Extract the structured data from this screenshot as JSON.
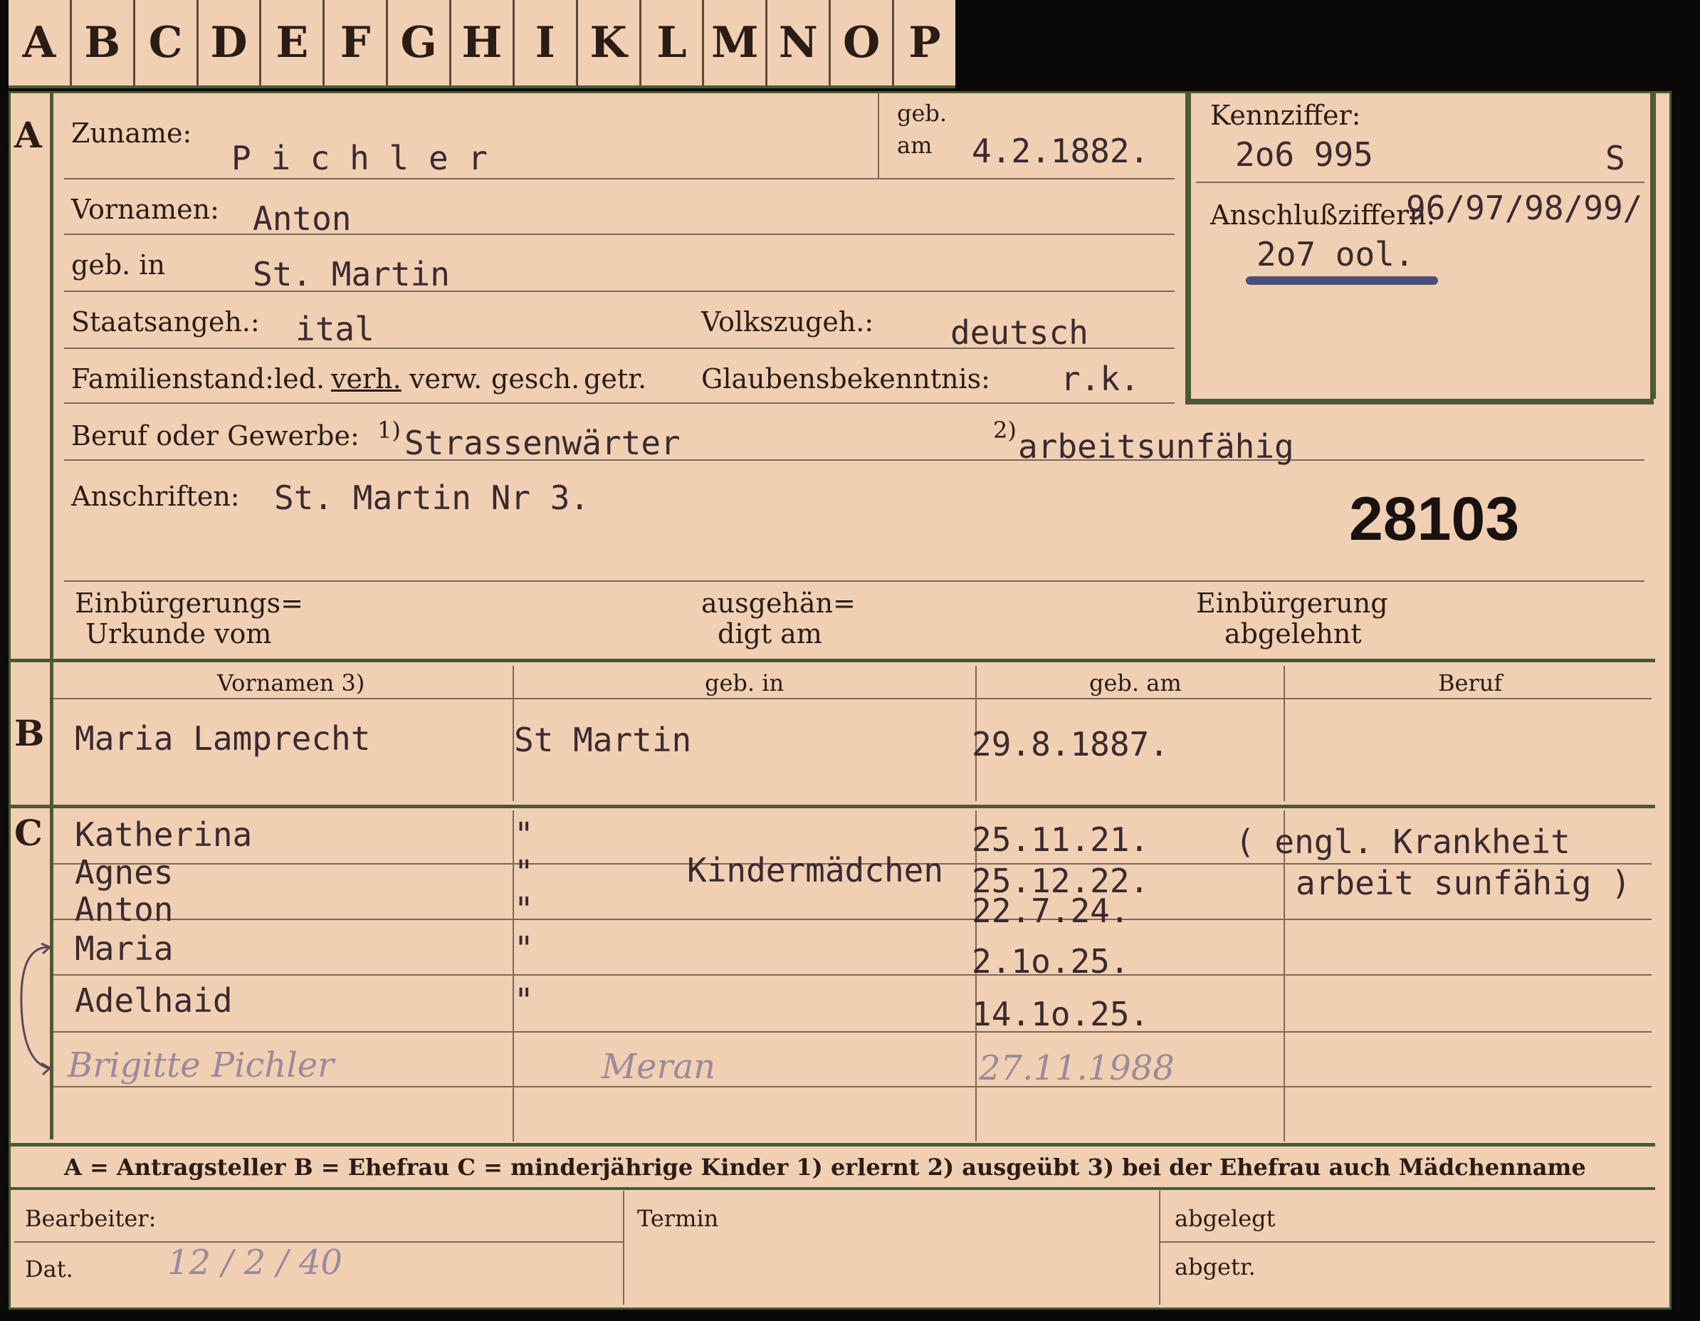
{
  "tabs": [
    "A",
    "B",
    "C",
    "D",
    "E",
    "F",
    "G",
    "H",
    "I",
    "K",
    "L",
    "M",
    "N",
    "O",
    "P"
  ],
  "section_a": {
    "marker": "A",
    "zuname_label": "Zuname:",
    "zuname": "P i c h l e r",
    "geb_label": "geb.",
    "am_label": "am",
    "geb_am": "4.2.1882.",
    "vornamen_label": "Vornamen:",
    "vornamen": "Anton",
    "geb_in_label": "geb. in",
    "geb_in": "St. Martin",
    "staatsangeh_label": "Staatsangeh.:",
    "staatsangeh": "ital",
    "volkszugeh_label": "Volkszugeh.:",
    "volkszugeh": "deutsch",
    "familienstand_label": "Familienstand:",
    "familienstand_options": [
      "led.",
      "verh.",
      "verw.",
      "gesch.",
      "getr."
    ],
    "glaubens_label": "Glaubensbekenntnis:",
    "glaubens": "r.k.",
    "beruf_label": "Beruf oder Gewerbe:",
    "beruf_note1": "1)",
    "beruf": "Strassenwärter",
    "beruf_note2": "2)",
    "beruf2": "arbeitsunfähig",
    "anschriften_label": "Anschriften:",
    "anschriften": "St. Martin Nr 3.",
    "stamp_number": "28103",
    "einb_urkunde_line1": "Einbürgerungs=",
    "einb_urkunde_line2": "Urkunde vom",
    "ausgehaendigt_line1": "ausgehän=",
    "ausgehaendigt_line2": "digt am",
    "einb_abgelehnt_line1": "Einbürgerung",
    "einb_abgelehnt_line2": "abgelehnt"
  },
  "kennziffer": {
    "label": "Kennziffer:",
    "value": "2o6 995",
    "suffix": "S",
    "anschluss_label": "Anschlußziffern:",
    "anschluss_value": "96/97/98/99/",
    "anschluss_value2": "2o7 ool."
  },
  "section_b": {
    "marker": "B",
    "col_vornamen": "Vornamen 3)",
    "col_geb_in": "geb. in",
    "col_geb_am": "geb. am",
    "col_beruf": "Beruf",
    "vornamen": "Maria Lamprecht",
    "geb_in": "St Martin",
    "geb_am": "29.8.1887."
  },
  "section_c": {
    "marker": "C",
    "rows": [
      {
        "name": "Katherina",
        "ditto": "\"",
        "date": "25.11.21."
      },
      {
        "name": "Agnes",
        "ditto": "\"",
        "date": "25.12.22."
      },
      {
        "name": "Anton",
        "ditto": "\"",
        "date": "22.7.24."
      },
      {
        "name": "Maria",
        "ditto": "\"",
        "date": "2.1o.25."
      },
      {
        "name": "Adelhaid",
        "ditto": "\"",
        "date": "14.1o.25."
      }
    ],
    "kindermaedchen": "Kindermädchen",
    "note_line1": "( engl. Krankheit",
    "note_line2": "arbeit sunfähig )",
    "hand_name": "Brigitte Pichler",
    "hand_place": "Meran",
    "hand_date": "27.11.1988"
  },
  "legend": {
    "text": "A = Antragsteller   B = Ehefrau   C = minderjährige Kinder   1) erlernt   2) ausgeübt   3) bei der Ehefrau auch Mädchenname"
  },
  "footer": {
    "bearbeiter_label": "Bearbeiter:",
    "dat_label": "Dat.",
    "dat_value": "12 / 2 / 40",
    "termin_label": "Termin",
    "abgelegt_label": "abgelegt",
    "abgetr_label": "abgetr."
  },
  "colors": {
    "card": "#f0cfb3",
    "border_green": "#4a5a34",
    "ink": "#2a1d16",
    "typewriter": "#3a2a30",
    "blue_pencil": "#2a3a6a"
  }
}
